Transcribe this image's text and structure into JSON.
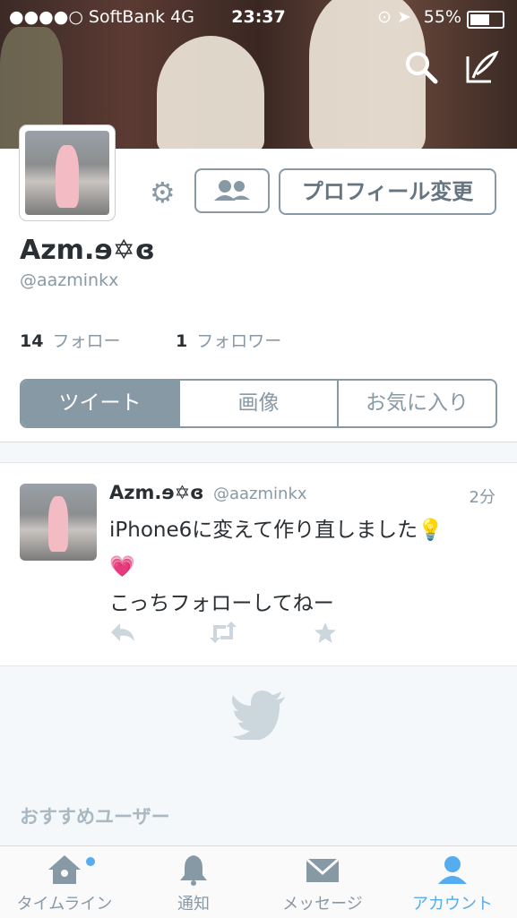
{
  "status_bar": {
    "carrier": "●●●●○ SoftBank   4G",
    "time": "23:37",
    "battery": "55%"
  },
  "header": {
    "search_icon": "search-icon",
    "compose_icon": "compose-icon"
  },
  "profile": {
    "name": "Azm.ɘ✡ɞ",
    "handle": "@aazminkx",
    "edit_label": "プロフィール変更",
    "following_count": "14",
    "following_label": "フォロー",
    "followers_count": "1",
    "followers_label": "フォロワー"
  },
  "tabs": [
    "ツイート",
    "画像",
    "お気に入り"
  ],
  "tweet": {
    "name": "Azm.ɘ✡ɞ",
    "handle": "@aazminkx",
    "time": "2分",
    "text": "iPhone6に変えて作り直しました💡\n💗\nこっちフォローしてねー"
  },
  "suggested_label": "おすすめユーザー",
  "tabbar": {
    "home": "タイムライン",
    "notifications": "通知",
    "messages": "メッセージ",
    "account": "アカウント"
  },
  "colors": {
    "accent": "#55acee",
    "muted": "#8899a6"
  }
}
